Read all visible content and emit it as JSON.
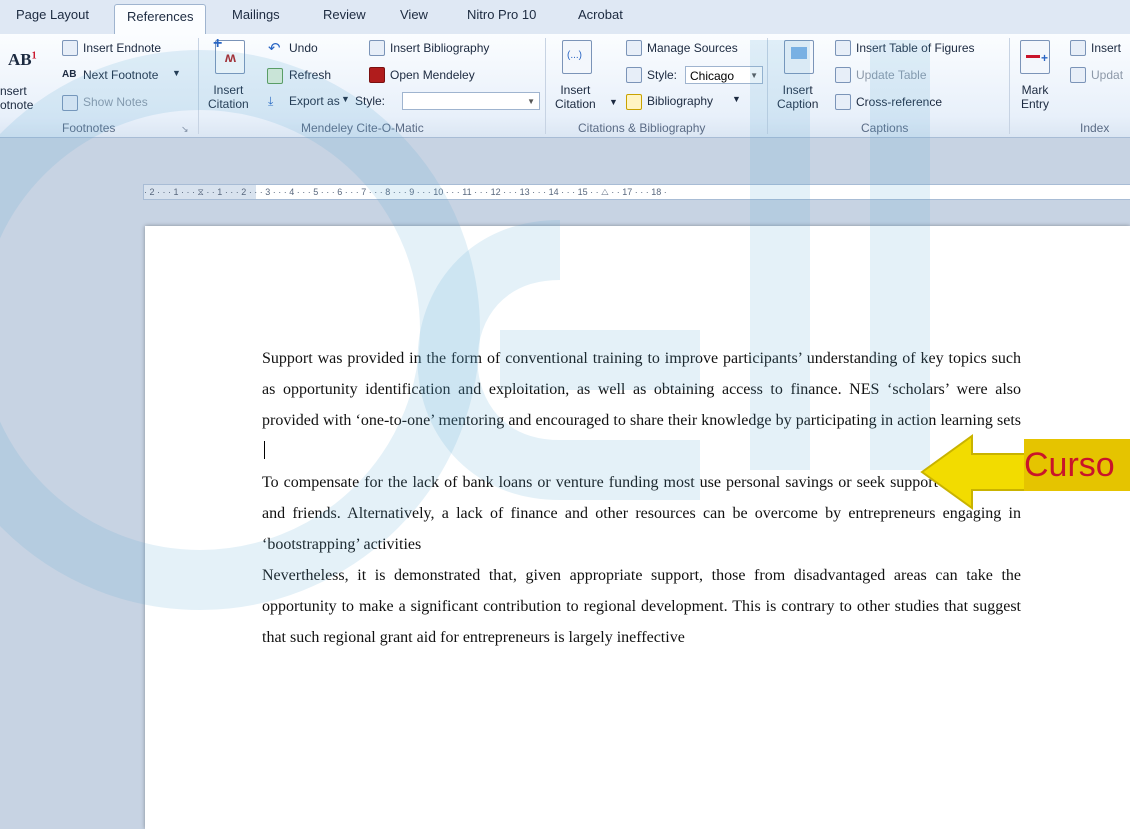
{
  "tabs": [
    "Page Layout",
    "References",
    "Mailings",
    "Review",
    "View",
    "Nitro Pro 10",
    "Acrobat"
  ],
  "active_tab": "References",
  "ribbon": {
    "footnotes": {
      "insert_footnote": "nsert\notnote",
      "insert_endnote": "Insert Endnote",
      "next_footnote": "Next Footnote",
      "show_notes": "Show Notes",
      "group_label": "Footnotes"
    },
    "mendeley": {
      "insert_citation": "Insert\nCitation",
      "undo": "Undo",
      "refresh": "Refresh",
      "export_as": "Export as",
      "style_label": "Style:",
      "style_value": "",
      "insert_bibliography": "Insert Bibliography",
      "open_mendeley": "Open Mendeley",
      "group_label": "Mendeley Cite-O-Matic"
    },
    "citations": {
      "insert_citation": "Insert\nCitation",
      "manage_sources": "Manage Sources",
      "style_label": "Style:",
      "style_value": "Chicago",
      "bibliography": "Bibliography",
      "group_label": "Citations & Bibliography"
    },
    "captions": {
      "insert_caption": "Insert\nCaption",
      "insert_table_of_figures": "Insert Table of Figures",
      "update_table": "Update Table",
      "cross_reference": "Cross-reference",
      "group_label": "Captions"
    },
    "index": {
      "mark_entry": "Mark\nEntry",
      "insert_index": "Insert",
      "update_index": "Updat",
      "group_label": "Index"
    }
  },
  "ruler_text": "· 2 · · · 1 · · · ⧖ · · 1 · · · 2 · · · 3 · · · 4 · · · 5 · · · 6 · · · 7 · · · 8 · · · 9 · · · 10 · · · 11 · · · 12 · · · 13 · · · 14 · · · 15 · · △ · · 17 · · · 18 ·",
  "document": {
    "paragraphs": [
      "Support was provided in the form of conventional training to improve participants’ understanding of key topics such as opportunity identification and exploitation, as well as obtaining access to finance. NES ‘scholars’ were also provided with ‘one-to-one’ mentoring and encouraged to share their knowledge by participating in action learning sets",
      "To compensate for the lack of bank loans or venture funding most use personal savings or seek support from family and friends. Alternatively, a lack of finance and other resources can be overcome by entrepreneurs engaging in ‘bootstrapping’ activities",
      "Nevertheless, it is demonstrated that, given appropriate support, those from disadvantaged areas can take the opportunity to make a significant contribution to regional development. This is contrary to other studies that suggest that such regional grant aid for entrepreneurs is largely ineffective"
    ]
  },
  "annotation": {
    "label": "Curso",
    "arrow_color": "#f2dc00"
  }
}
